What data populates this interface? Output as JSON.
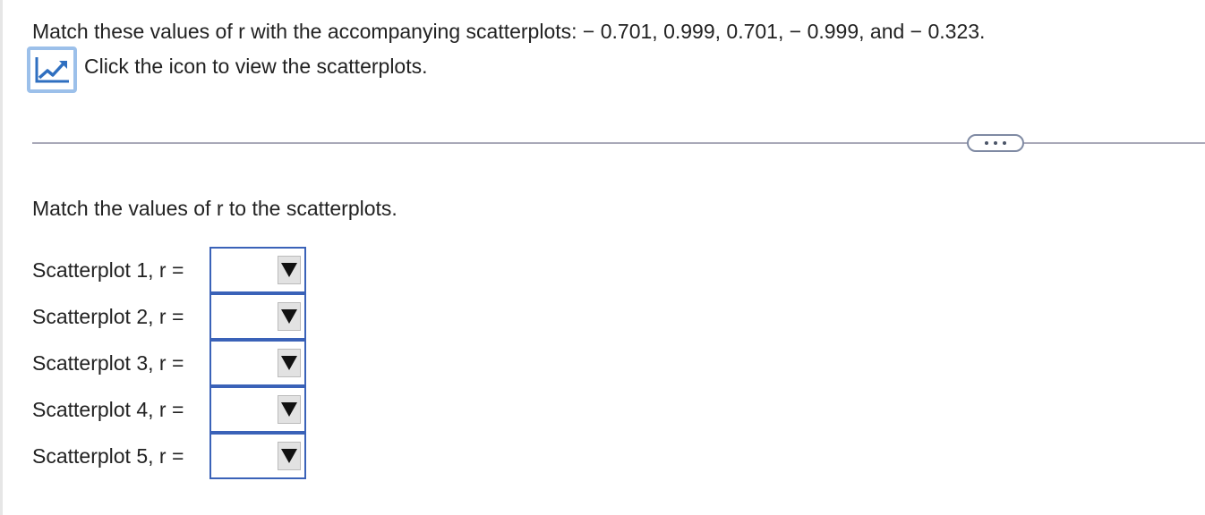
{
  "question": {
    "text": "Match these values of r with the accompanying scatterplots:  − 0.701, 0.999, 0.701,  − 0.999, and  − 0.323."
  },
  "view_link": {
    "icon": "line-chart-icon",
    "text": "Click the icon to view the scatterplots."
  },
  "more_button": {
    "icon": "ellipsis-icon"
  },
  "instruction": "Match the values of r to the scatterplots.",
  "rows": [
    {
      "label": "Scatterplot 1, r =",
      "value": ""
    },
    {
      "label": "Scatterplot 2, r =",
      "value": ""
    },
    {
      "label": "Scatterplot 3, r =",
      "value": ""
    },
    {
      "label": "Scatterplot 4, r =",
      "value": ""
    },
    {
      "label": "Scatterplot 5, r =",
      "value": ""
    }
  ],
  "colors": {
    "select_border": "#3a62b8",
    "icon_border": "#9cc0ea",
    "divider": "#a9a9b8"
  }
}
